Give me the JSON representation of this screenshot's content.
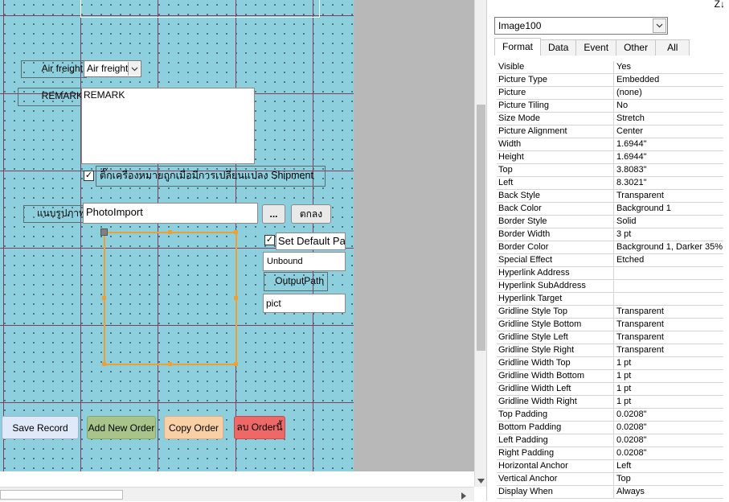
{
  "form": {
    "freight_label": "Air freight",
    "freight_combo_value": "Air freight",
    "remark_label": "REMARK",
    "remark_value": "REMARK",
    "checkbox_label": "ติ๊กเครื่องหมายถูกเมื่อมีการเปลี่ยนแปลง Shipment",
    "attach_label": "แนบรูปภาพ",
    "photo_import_value": "PhotoImport",
    "browse_label": "...",
    "ok_label": "ตกลง",
    "set_default_label": "Set Default Pa",
    "unbound_value": "Unbound",
    "output_path_label": "OutputPath",
    "pict_value": "pict",
    "buttons": {
      "save": "Save Record",
      "add": "Add New Order",
      "copy": "Copy Order",
      "delete": "ลบ Orderนี้"
    }
  },
  "colors": {
    "canvas": "#8ecfdd",
    "save_button": "#dfe9f7",
    "add_button": "#a9c48a",
    "copy_button": "#f9cfa6",
    "delete_button": "#ef6868",
    "selection": "#f0a030"
  },
  "panel": {
    "sort_icon": "Z↓",
    "selector_value": "Image100",
    "tabs": [
      "Format",
      "Data",
      "Event",
      "Other",
      "All"
    ],
    "active_tab": "Format",
    "properties": [
      {
        "name": "Visible",
        "value": "Yes"
      },
      {
        "name": "Picture Type",
        "value": "Embedded"
      },
      {
        "name": "Picture",
        "value": "(none)"
      },
      {
        "name": "Picture Tiling",
        "value": "No"
      },
      {
        "name": "Size Mode",
        "value": "Stretch"
      },
      {
        "name": "Picture Alignment",
        "value": "Center"
      },
      {
        "name": "Width",
        "value": "1.6944\""
      },
      {
        "name": "Height",
        "value": "1.6944\""
      },
      {
        "name": "Top",
        "value": "3.8083\""
      },
      {
        "name": "Left",
        "value": "8.3021\""
      },
      {
        "name": "Back Style",
        "value": "Transparent"
      },
      {
        "name": "Back Color",
        "value": "Background 1"
      },
      {
        "name": "Border Style",
        "value": "Solid"
      },
      {
        "name": "Border Width",
        "value": "3 pt"
      },
      {
        "name": "Border Color",
        "value": "Background 1, Darker 35%"
      },
      {
        "name": "Special Effect",
        "value": "Etched"
      },
      {
        "name": "Hyperlink Address",
        "value": ""
      },
      {
        "name": "Hyperlink SubAddress",
        "value": ""
      },
      {
        "name": "Hyperlink Target",
        "value": ""
      },
      {
        "name": "Gridline Style Top",
        "value": "Transparent"
      },
      {
        "name": "Gridline Style Bottom",
        "value": "Transparent"
      },
      {
        "name": "Gridline Style Left",
        "value": "Transparent"
      },
      {
        "name": "Gridline Style Right",
        "value": "Transparent"
      },
      {
        "name": "Gridline Width Top",
        "value": "1 pt"
      },
      {
        "name": "Gridline Width Bottom",
        "value": "1 pt"
      },
      {
        "name": "Gridline Width Left",
        "value": "1 pt"
      },
      {
        "name": "Gridline Width Right",
        "value": "1 pt"
      },
      {
        "name": "Top Padding",
        "value": "0.0208\""
      },
      {
        "name": "Bottom Padding",
        "value": "0.0208\""
      },
      {
        "name": "Left Padding",
        "value": "0.0208\""
      },
      {
        "name": "Right Padding",
        "value": "0.0208\""
      },
      {
        "name": "Horizontal Anchor",
        "value": "Left"
      },
      {
        "name": "Vertical Anchor",
        "value": "Top"
      },
      {
        "name": "Display When",
        "value": "Always"
      }
    ]
  }
}
